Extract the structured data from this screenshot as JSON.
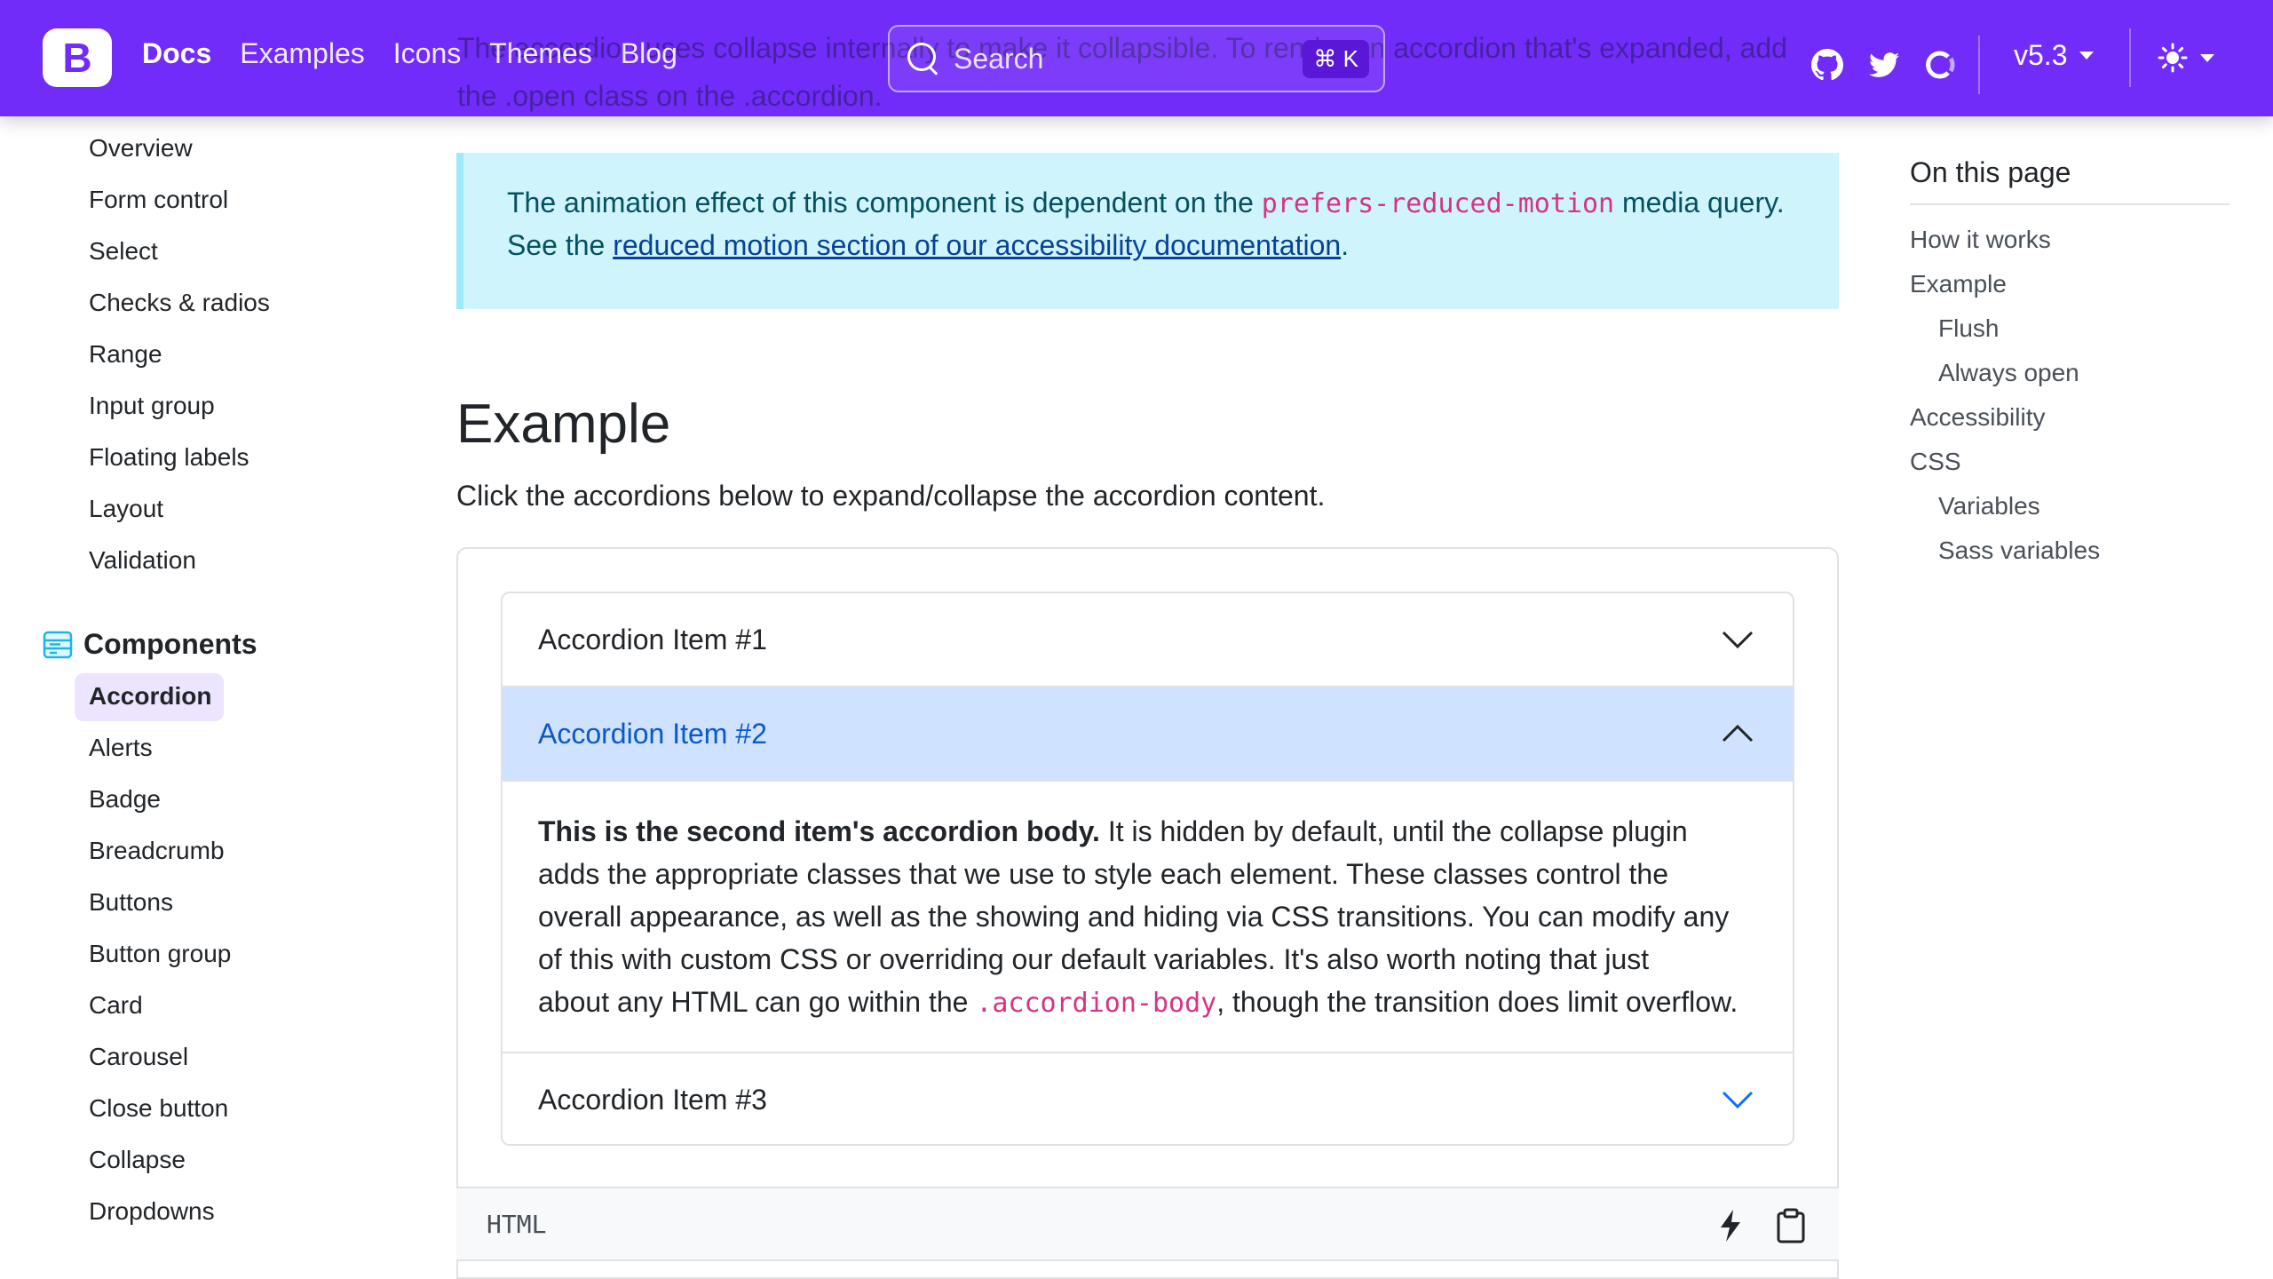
{
  "navbar": {
    "brand": "B",
    "links": [
      {
        "label": "Docs",
        "active": true
      },
      {
        "label": "Examples",
        "active": false
      },
      {
        "label": "Icons",
        "active": false
      },
      {
        "label": "Themes",
        "active": false
      },
      {
        "label": "Blog",
        "active": false
      }
    ],
    "search_label": "Search",
    "search_shortcut": "⌘ K",
    "icons": [
      "github-icon",
      "twitter-icon",
      "opencollective-icon"
    ],
    "version": "v5.3",
    "theme_icon": "sun-icon",
    "color": "#712cf9"
  },
  "underlay": {
    "line1": "The accordion uses collapse internally to make it collapsible. To render an accordion that's expanded, add",
    "line2": "the .open class on the .accordion."
  },
  "sidebar": {
    "forms_items": [
      "Overview",
      "Form control",
      "Select",
      "Checks & radios",
      "Range",
      "Input group",
      "Floating labels",
      "Layout",
      "Validation"
    ],
    "components_label": "Components",
    "components_items": [
      "Accordion",
      "Alerts",
      "Badge",
      "Breadcrumb",
      "Buttons",
      "Button group",
      "Card",
      "Carousel",
      "Close button",
      "Collapse",
      "Dropdowns"
    ],
    "active_item": "Accordion"
  },
  "callout": {
    "line1_text": "The animation effect of this component is dependent on the ",
    "line1_code": "prefers-reduced-motion",
    "line1_tail": " media query.",
    "line2_text": "See the ",
    "line2_link": "reduced motion section of our accessibility documentation",
    "line2_tail": "."
  },
  "section": {
    "heading": "Example",
    "lead": "Click the accordions below to expand/collapse the accordion content."
  },
  "accordion": {
    "items": [
      {
        "title": "Accordion Item #1",
        "expanded": false
      },
      {
        "title": "Accordion Item #2",
        "expanded": true
      },
      {
        "title": "Accordion Item #3",
        "expanded": false
      }
    ],
    "body_strong": "This is the second item's accordion body.",
    "body_line1": " It is hidden by default, until the collapse plugin",
    "body_line2": "adds the appropriate classes that we use to style each element. These classes control the",
    "body_line3": "overall appearance, as well as the showing and hiding via CSS transitions. You can modify any",
    "body_line4": "of this with custom CSS or overriding our default variables. It's also worth noting that just",
    "body_line5_pre": "about any HTML can go within the ",
    "body_line5_code": ".accordion-body",
    "body_line5_post": ", though the transition does limit overflow."
  },
  "code_bar": {
    "lang": "HTML",
    "icons": [
      "lightning-icon",
      "clipboard-icon"
    ]
  },
  "toc": {
    "title": "On this page",
    "items": [
      {
        "label": "How it works",
        "level": 1
      },
      {
        "label": "Example",
        "level": 1
      },
      {
        "label": "Flush",
        "level": 2
      },
      {
        "label": "Always open",
        "level": 2
      },
      {
        "label": "Accessibility",
        "level": 1
      },
      {
        "label": "CSS",
        "level": 1
      },
      {
        "label": "Variables",
        "level": 2
      },
      {
        "label": "Sass variables",
        "level": 2
      }
    ]
  },
  "colors": {
    "accent": "#712cf9",
    "callout_bg": "#cff4fc",
    "accordion_active_bg": "#cfe2ff",
    "accordion_active_text": "#052c65",
    "code": "#d63384",
    "link": "#0d6efd"
  }
}
